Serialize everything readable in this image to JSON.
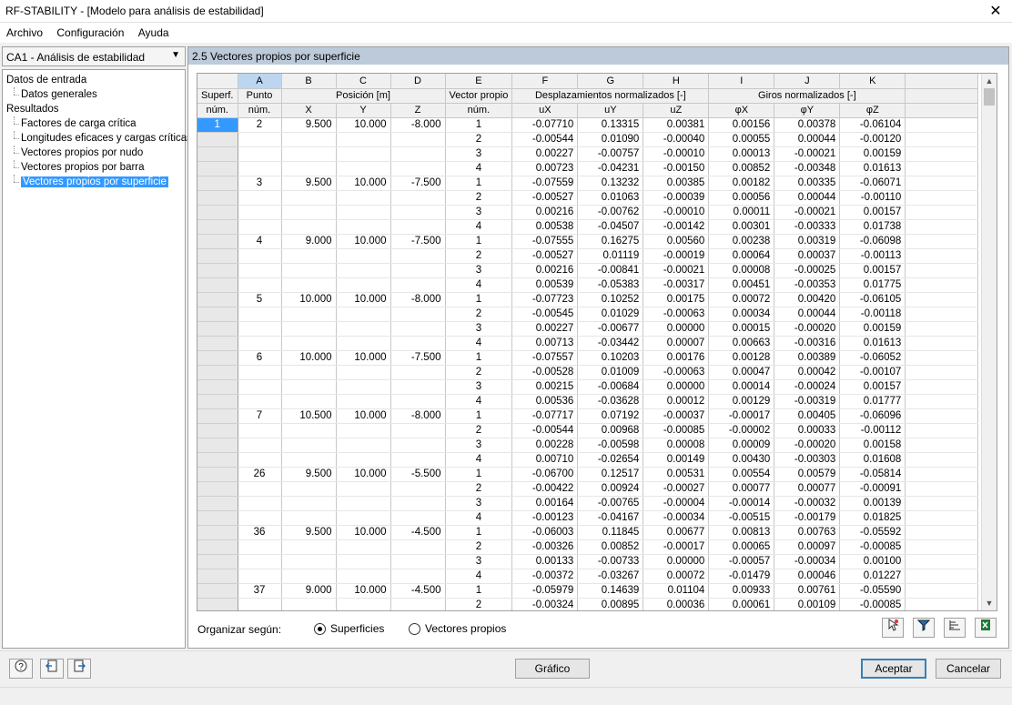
{
  "window": {
    "title": "RF-STABILITY - [Modelo para análisis de estabilidad]",
    "close_glyph": "✕"
  },
  "menu": [
    "Archivo",
    "Configuración",
    "Ayuda"
  ],
  "case_select": {
    "value": "CA1 - Análisis de estabilidad"
  },
  "tree": [
    {
      "label": "Datos de entrada",
      "level": 0
    },
    {
      "label": "Datos generales",
      "level": 1
    },
    {
      "label": "Resultados",
      "level": 0
    },
    {
      "label": "Factores de carga crítica",
      "level": 1
    },
    {
      "label": "Longitudes eficaces y cargas críticas",
      "level": 1
    },
    {
      "label": "Vectores propios por nudo",
      "level": 1
    },
    {
      "label": "Vectores propios por barra",
      "level": 1
    },
    {
      "label": "Vectores propios por superficie",
      "level": 1,
      "selected": true
    }
  ],
  "panel_title": "2.5 Vectores propios por superficie",
  "table": {
    "col_letters": [
      "A",
      "B",
      "C",
      "D",
      "E",
      "F",
      "G",
      "H",
      "I",
      "J",
      "K"
    ],
    "group_headers": {
      "superf": "Superf.",
      "superf2": "núm.",
      "punto": "Punto",
      "punto2": "núm.",
      "posicion": "Posición [m]",
      "vector": "Vector propio",
      "vector2": "núm.",
      "desplaz": "Desplazamientos normalizados [-]",
      "giros": "Giros normalizados [-]"
    },
    "sub_headers": [
      "X",
      "Y",
      "Z",
      "uX",
      "uY",
      "uZ",
      "φX",
      "φY",
      "φZ"
    ],
    "rows": [
      [
        "1",
        "2",
        "9.500",
        "10.000",
        "-8.000",
        "1",
        "-0.07710",
        "0.13315",
        "0.00381",
        "0.00156",
        "0.00378",
        "-0.06104"
      ],
      [
        "",
        "",
        "",
        "",
        "",
        "2",
        "-0.00544",
        "0.01090",
        "-0.00040",
        "0.00055",
        "0.00044",
        "-0.00120"
      ],
      [
        "",
        "",
        "",
        "",
        "",
        "3",
        "0.00227",
        "-0.00757",
        "-0.00010",
        "0.00013",
        "-0.00021",
        "0.00159"
      ],
      [
        "",
        "",
        "",
        "",
        "",
        "4",
        "0.00723",
        "-0.04231",
        "-0.00150",
        "0.00852",
        "-0.00348",
        "0.01613"
      ],
      [
        "",
        "3",
        "9.500",
        "10.000",
        "-7.500",
        "1",
        "-0.07559",
        "0.13232",
        "0.00385",
        "0.00182",
        "0.00335",
        "-0.06071"
      ],
      [
        "",
        "",
        "",
        "",
        "",
        "2",
        "-0.00527",
        "0.01063",
        "-0.00039",
        "0.00056",
        "0.00044",
        "-0.00110"
      ],
      [
        "",
        "",
        "",
        "",
        "",
        "3",
        "0.00216",
        "-0.00762",
        "-0.00010",
        "0.00011",
        "-0.00021",
        "0.00157"
      ],
      [
        "",
        "",
        "",
        "",
        "",
        "4",
        "0.00538",
        "-0.04507",
        "-0.00142",
        "0.00301",
        "-0.00333",
        "0.01738"
      ],
      [
        "",
        "4",
        "9.000",
        "10.000",
        "-7.500",
        "1",
        "-0.07555",
        "0.16275",
        "0.00560",
        "0.00238",
        "0.00319",
        "-0.06098"
      ],
      [
        "",
        "",
        "",
        "",
        "",
        "2",
        "-0.00527",
        "0.01119",
        "-0.00019",
        "0.00064",
        "0.00037",
        "-0.00113"
      ],
      [
        "",
        "",
        "",
        "",
        "",
        "3",
        "0.00216",
        "-0.00841",
        "-0.00021",
        "0.00008",
        "-0.00025",
        "0.00157"
      ],
      [
        "",
        "",
        "",
        "",
        "",
        "4",
        "0.00539",
        "-0.05383",
        "-0.00317",
        "0.00451",
        "-0.00353",
        "0.01775"
      ],
      [
        "",
        "5",
        "10.000",
        "10.000",
        "-8.000",
        "1",
        "-0.07723",
        "0.10252",
        "0.00175",
        "0.00072",
        "0.00420",
        "-0.06105"
      ],
      [
        "",
        "",
        "",
        "",
        "",
        "2",
        "-0.00545",
        "0.01029",
        "-0.00063",
        "0.00034",
        "0.00044",
        "-0.00118"
      ],
      [
        "",
        "",
        "",
        "",
        "",
        "3",
        "0.00227",
        "-0.00677",
        "0.00000",
        "0.00015",
        "-0.00020",
        "0.00159"
      ],
      [
        "",
        "",
        "",
        "",
        "",
        "4",
        "0.00713",
        "-0.03442",
        "0.00007",
        "0.00663",
        "-0.00316",
        "0.01613"
      ],
      [
        "",
        "6",
        "10.000",
        "10.000",
        "-7.500",
        "1",
        "-0.07557",
        "0.10203",
        "0.00176",
        "0.00128",
        "0.00389",
        "-0.06052"
      ],
      [
        "",
        "",
        "",
        "",
        "",
        "2",
        "-0.00528",
        "0.01009",
        "-0.00063",
        "0.00047",
        "0.00042",
        "-0.00107"
      ],
      [
        "",
        "",
        "",
        "",
        "",
        "3",
        "0.00215",
        "-0.00684",
        "0.00000",
        "0.00014",
        "-0.00024",
        "0.00157"
      ],
      [
        "",
        "",
        "",
        "",
        "",
        "4",
        "0.00536",
        "-0.03628",
        "0.00012",
        "0.00129",
        "-0.00319",
        "0.01777"
      ],
      [
        "",
        "7",
        "10.500",
        "10.000",
        "-8.000",
        "1",
        "-0.07717",
        "0.07192",
        "-0.00037",
        "-0.00017",
        "0.00405",
        "-0.06096"
      ],
      [
        "",
        "",
        "",
        "",
        "",
        "2",
        "-0.00544",
        "0.00968",
        "-0.00085",
        "-0.00002",
        "0.00033",
        "-0.00112"
      ],
      [
        "",
        "",
        "",
        "",
        "",
        "3",
        "0.00228",
        "-0.00598",
        "0.00008",
        "0.00009",
        "-0.00020",
        "0.00158"
      ],
      [
        "",
        "",
        "",
        "",
        "",
        "4",
        "0.00710",
        "-0.02654",
        "0.00149",
        "0.00430",
        "-0.00303",
        "0.01608"
      ],
      [
        "",
        "26",
        "9.500",
        "10.000",
        "-5.500",
        "1",
        "-0.06700",
        "0.12517",
        "0.00531",
        "0.00554",
        "0.00579",
        "-0.05814"
      ],
      [
        "",
        "",
        "",
        "",
        "",
        "2",
        "-0.00422",
        "0.00924",
        "-0.00027",
        "0.00077",
        "0.00077",
        "-0.00091"
      ],
      [
        "",
        "",
        "",
        "",
        "",
        "3",
        "0.00164",
        "-0.00765",
        "-0.00004",
        "-0.00014",
        "-0.00032",
        "0.00139"
      ],
      [
        "",
        "",
        "",
        "",
        "",
        "4",
        "-0.00123",
        "-0.04167",
        "-0.00034",
        "-0.00515",
        "-0.00179",
        "0.01825"
      ],
      [
        "",
        "36",
        "9.500",
        "10.000",
        "-4.500",
        "1",
        "-0.06003",
        "0.11845",
        "0.00677",
        "0.00813",
        "0.00763",
        "-0.05592"
      ],
      [
        "",
        "",
        "",
        "",
        "",
        "2",
        "-0.00326",
        "0.00852",
        "-0.00017",
        "0.00065",
        "0.00097",
        "-0.00085"
      ],
      [
        "",
        "",
        "",
        "",
        "",
        "3",
        "0.00133",
        "-0.00733",
        "0.00000",
        "-0.00057",
        "-0.00034",
        "0.00100"
      ],
      [
        "",
        "",
        "",
        "",
        "",
        "4",
        "-0.00372",
        "-0.03267",
        "0.00072",
        "-0.01479",
        "0.00046",
        "0.01227"
      ],
      [
        "",
        "37",
        "9.000",
        "10.000",
        "-4.500",
        "1",
        "-0.05979",
        "0.14639",
        "0.01104",
        "0.00933",
        "0.00761",
        "-0.05590"
      ],
      [
        "",
        "",
        "",
        "",
        "",
        "2",
        "-0.00324",
        "0.00895",
        "0.00036",
        "0.00061",
        "0.00109",
        "-0.00085"
      ]
    ]
  },
  "organize": {
    "label": "Organizar según:",
    "options": [
      {
        "label": "Superficies",
        "checked": true
      },
      {
        "label": "Vectores propios",
        "checked": false
      }
    ]
  },
  "buttons": {
    "grafico": "Gráfico",
    "aceptar": "Aceptar",
    "cancelar": "Cancelar"
  },
  "colors": {
    "selection": "#3399ff",
    "panel_header": "#bccad9",
    "column_highlight": "#bcd6f0"
  }
}
